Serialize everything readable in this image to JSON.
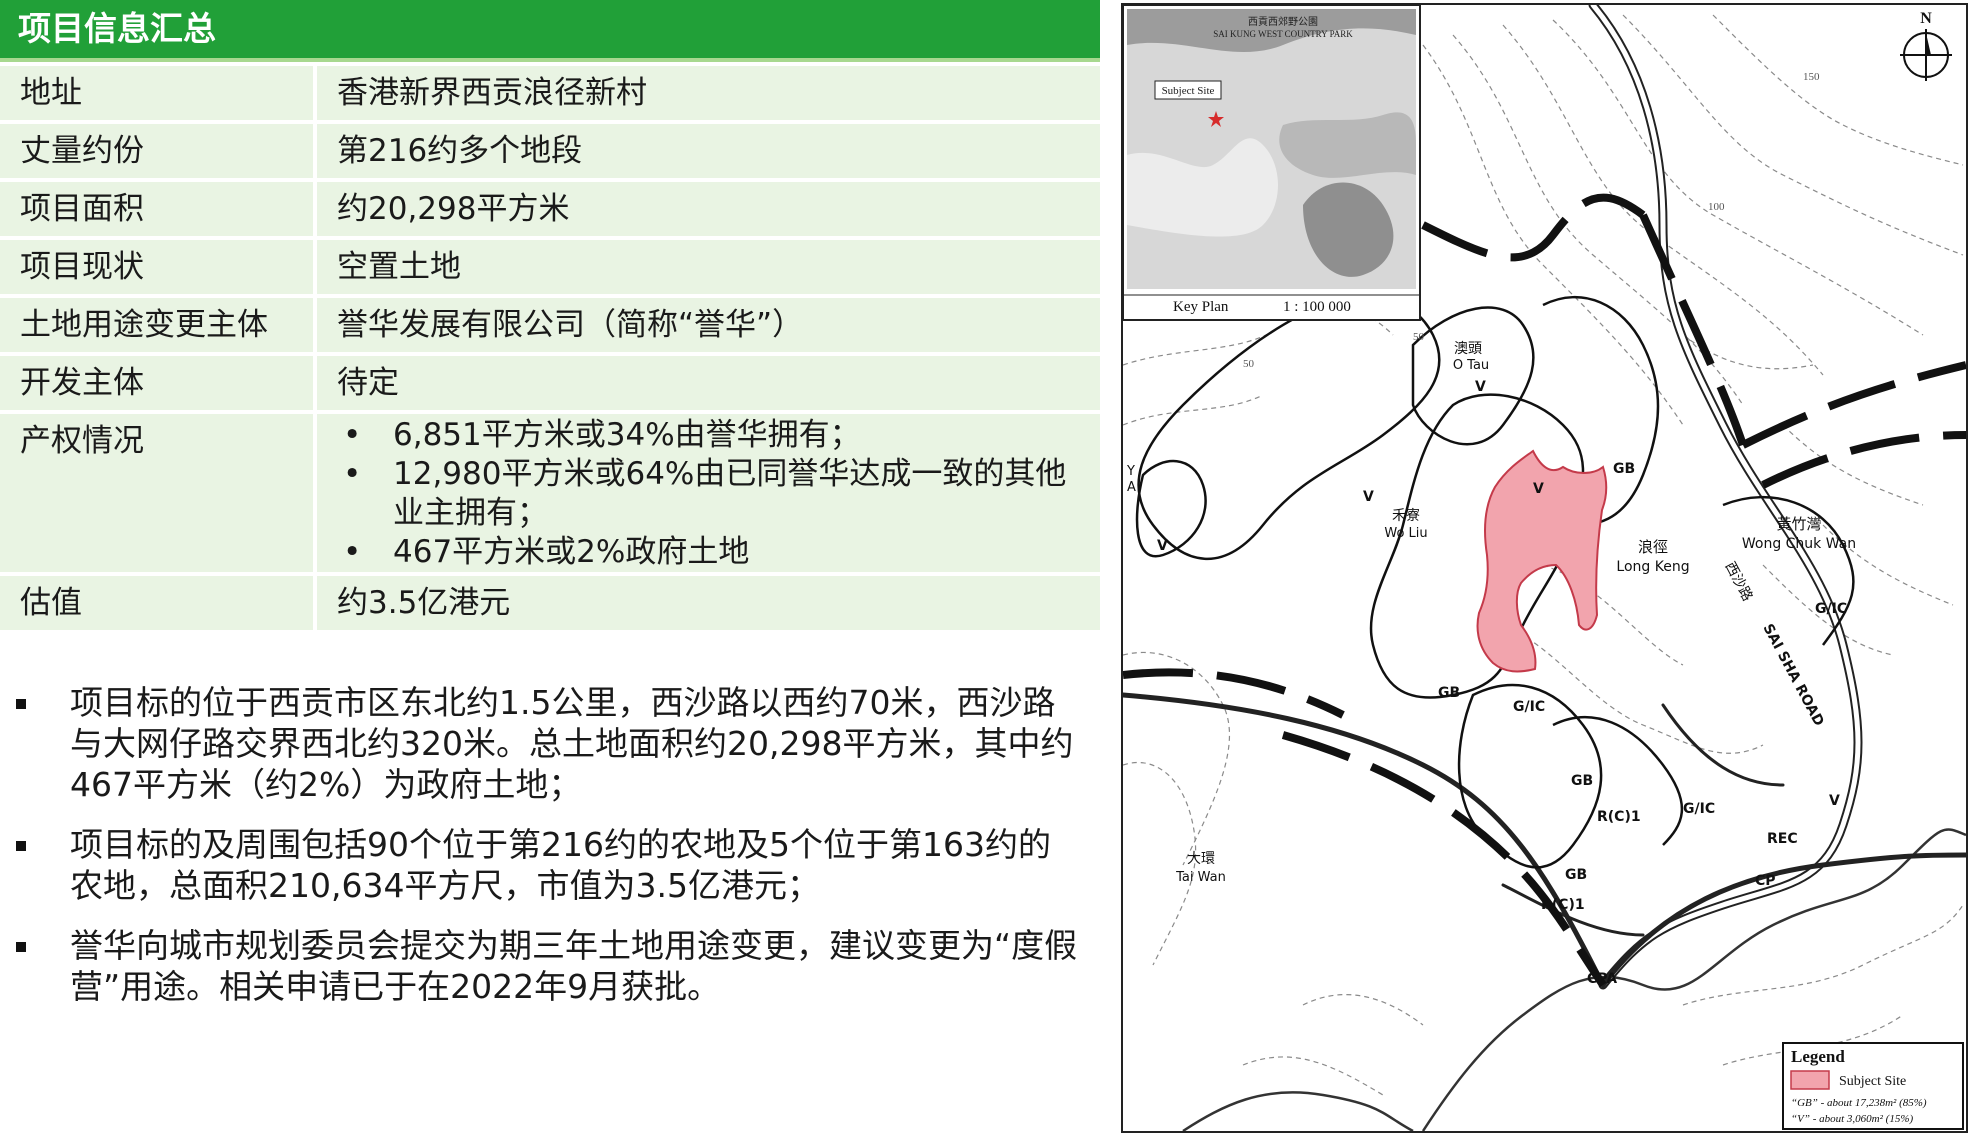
{
  "header": {
    "title": "项目信息汇总"
  },
  "info_rows": [
    {
      "key": "地址",
      "value": "香港新界西贡浪径新村"
    },
    {
      "key": "丈量约份",
      "value": "第216约多个地段"
    },
    {
      "key": "项目面积",
      "value": "约20,298平方米"
    },
    {
      "key": "项目现状",
      "value": "空置土地"
    },
    {
      "key": "土地用途变更主体",
      "value": "誉华发展有限公司（简称“誉华”）"
    },
    {
      "key": "开发主体",
      "value": "待定"
    },
    {
      "key": "产权情况",
      "items": [
        "6,851平方米或34%由誉华拥有；",
        "12,980平方米或64%由已同誉华达成一致的其他业主拥有；",
        "467平方米或2%政府土地"
      ]
    },
    {
      "key": "估值",
      "value": "约3.5亿港元"
    }
  ],
  "bullets": [
    "项目标的位于西贡市区东北约1.5公里，西沙路以西约70米，西沙路与大网仔路交界西北约320米。总土地面积约20,298平方米，其中约467平方米（约2%）为政府土地；",
    "项目标的及周围包括90个位于第216约的农地及5个位于第163约的农地，总面积210,634平方尺，市值为3.5亿港元；",
    "誉华向城市规划委员会提交为期三年土地用途变更，建议变更为“度假营”用途。相关申请已于在2022年9月获批。"
  ],
  "map": {
    "north": "N",
    "key_plan": {
      "label": "Key Plan",
      "scale": "1 : 100 000",
      "subject_site": "Subject Site",
      "park_cn": "西貢西郊野公園",
      "park_en": "SAI KUNG WEST COUNTRY PARK"
    },
    "contours": [
      "150",
      "100",
      "50",
      "50"
    ],
    "place_labels": {
      "o_tau_cn": "澳頭",
      "o_tau_en": "O Tau",
      "wo_liu_cn": "禾寮",
      "wo_liu_en": "Wo Liu",
      "long_keng_cn": "浪徑",
      "long_keng_en": "Long Keng",
      "wong_chuk_wan_cn": "黃竹灣",
      "wong_chuk_wan_en": "Wong Chuk Wan",
      "tai_wan_cn": "大環",
      "tai_wan_en": "Tai Wan",
      "road_cn": "西沙路",
      "road_en": "SAI SHA ROAD",
      "edge_a": "A",
      "edge_y": "Y"
    },
    "zone_labels": {
      "gb_top": "GB",
      "v_site": "V",
      "v_otau": "V",
      "v_woliu": "V",
      "v_west": "V",
      "gb_west": "GB",
      "gic_1": "G/IC",
      "gic_2": "G/IC",
      "gic_3": "G/IC",
      "gb_south1": "GB",
      "rc1_a": "R(C)1",
      "gb_south2": "GB",
      "rc1_b": "R(C)1",
      "rec": "REC",
      "cp": "CP",
      "cpa": "CPA",
      "v_east": "V"
    },
    "legend": {
      "title": "Legend",
      "item": "Subject Site",
      "note_gb": "“GB” - about 17,238m² (85%)",
      "note_v": "“V” - about 3,060m² (15%)"
    },
    "colors": {
      "site_fill": "#f2a4ad",
      "site_stroke": "#c43a4a"
    }
  }
}
